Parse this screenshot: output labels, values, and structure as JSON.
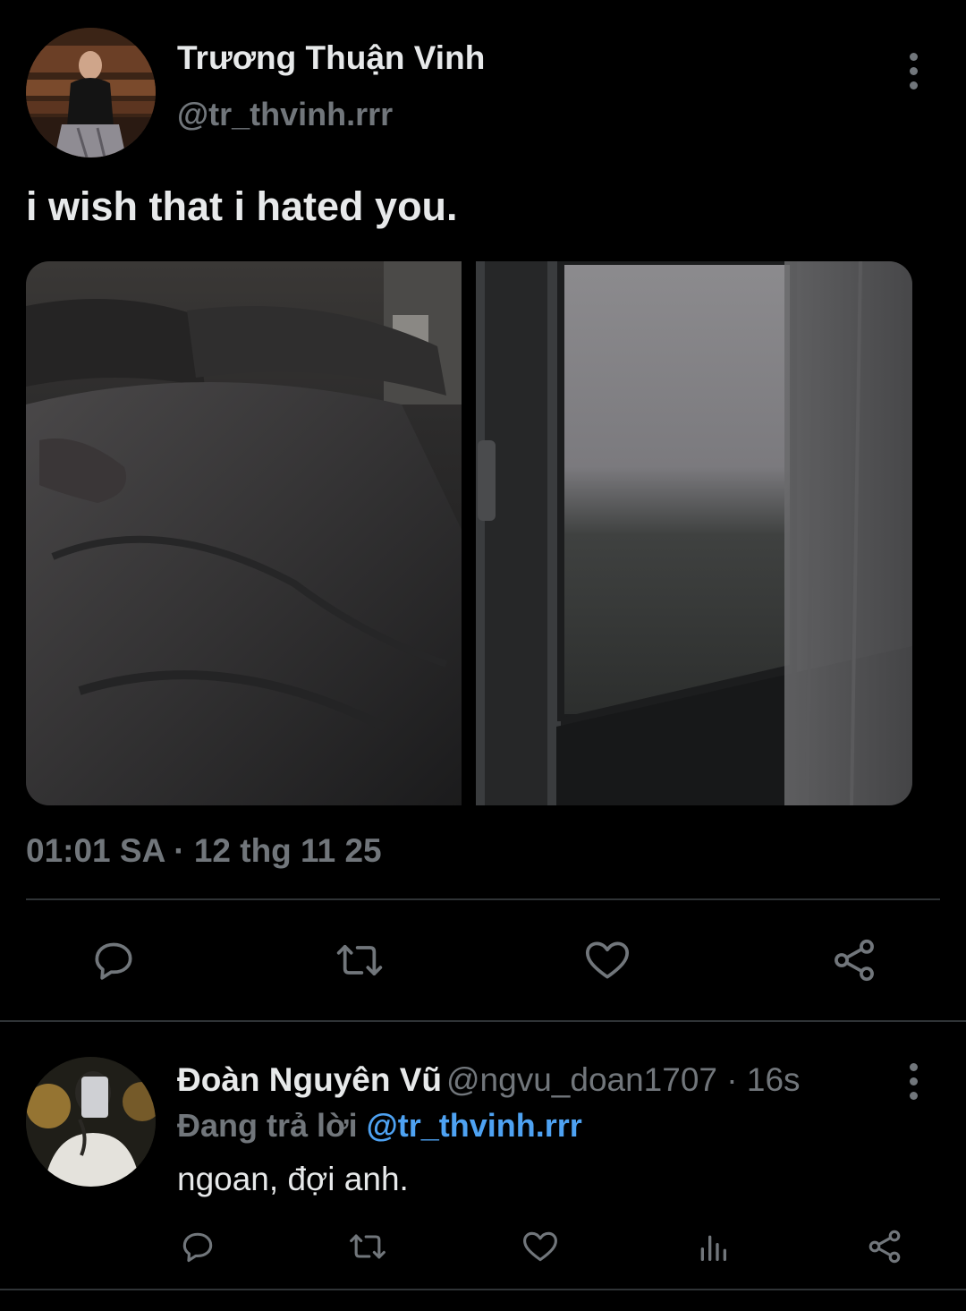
{
  "tweet": {
    "author_name": "Trương Thuận Vinh",
    "author_handle": "@tr_thvinh.rrr",
    "text": "i wish that i hated you.",
    "timestamp": "01:01 SA · 12 thg 11 25",
    "images": [
      {
        "description": "hospital-bed-photo"
      },
      {
        "description": "rainy-window-photo"
      }
    ],
    "actions": [
      "reply-icon",
      "retweet-icon",
      "like-icon",
      "share-icon"
    ]
  },
  "reply": {
    "author_name": "Đoàn Nguyên Vũ",
    "meta": "@ngvu_doan1707 · 16s",
    "replying_to_label": "Đang trả lời",
    "replying_to_handle": "@tr_thvinh.rrr",
    "text": "ngoan, đợi anh.",
    "actions": [
      "reply-icon",
      "retweet-icon",
      "like-icon",
      "views-icon",
      "share-icon"
    ]
  },
  "colors": {
    "background": "#000000",
    "primary_text": "#e7e9ea",
    "secondary_text": "#71767b",
    "link": "#4ea2f2",
    "divider": "#2f3336"
  }
}
